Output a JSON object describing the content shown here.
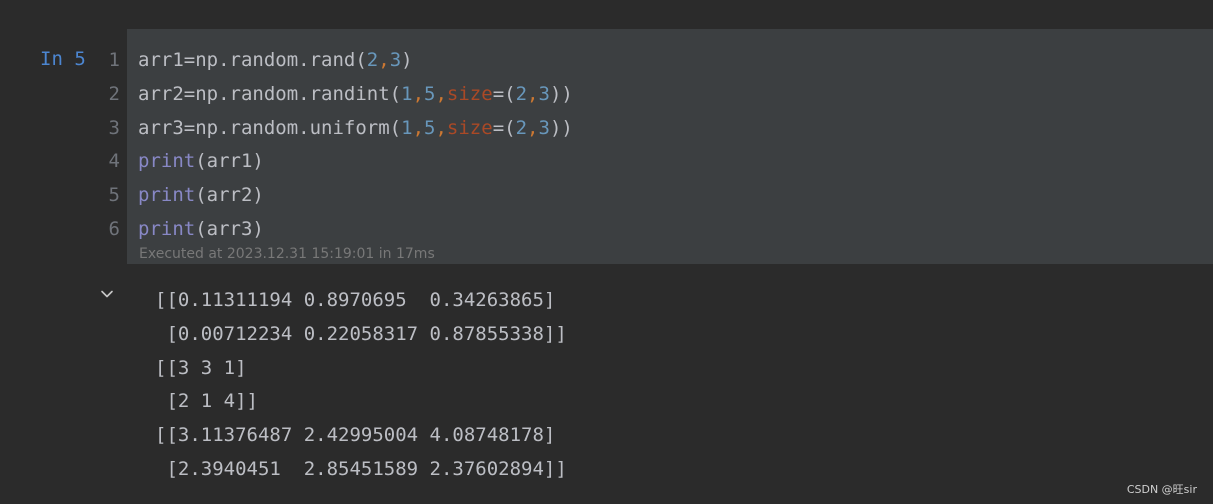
{
  "cell": {
    "label": "In 5",
    "line_numbers": [
      "1",
      "2",
      "3",
      "4",
      "5",
      "6"
    ],
    "code_lines": [
      [
        {
          "text": "arr1=np.random.rand(",
          "kind": "plain"
        },
        {
          "text": "2",
          "kind": "num"
        },
        {
          "text": ",",
          "kind": "comma"
        },
        {
          "text": "3",
          "kind": "num"
        },
        {
          "text": ")",
          "kind": "plain"
        }
      ],
      [
        {
          "text": "arr2=np.random.randint(",
          "kind": "plain"
        },
        {
          "text": "1",
          "kind": "num"
        },
        {
          "text": ",",
          "kind": "comma"
        },
        {
          "text": "5",
          "kind": "num"
        },
        {
          "text": ",",
          "kind": "comma"
        },
        {
          "text": "size",
          "kind": "kw"
        },
        {
          "text": "=(",
          "kind": "plain"
        },
        {
          "text": "2",
          "kind": "num"
        },
        {
          "text": ",",
          "kind": "comma"
        },
        {
          "text": "3",
          "kind": "num"
        },
        {
          "text": "))",
          "kind": "plain"
        }
      ],
      [
        {
          "text": "arr3=np.random.uniform(",
          "kind": "plain"
        },
        {
          "text": "1",
          "kind": "num"
        },
        {
          "text": ",",
          "kind": "comma"
        },
        {
          "text": "5",
          "kind": "num"
        },
        {
          "text": ",",
          "kind": "comma"
        },
        {
          "text": "size",
          "kind": "kw"
        },
        {
          "text": "=(",
          "kind": "plain"
        },
        {
          "text": "2",
          "kind": "num"
        },
        {
          "text": ",",
          "kind": "comma"
        },
        {
          "text": "3",
          "kind": "num"
        },
        {
          "text": "))",
          "kind": "plain"
        }
      ],
      [
        {
          "text": "print",
          "kind": "fn"
        },
        {
          "text": "(arr1)",
          "kind": "plain"
        }
      ],
      [
        {
          "text": "print",
          "kind": "fn"
        },
        {
          "text": "(arr2)",
          "kind": "plain"
        }
      ],
      [
        {
          "text": "print",
          "kind": "fn"
        },
        {
          "text": "(arr3)",
          "kind": "plain"
        }
      ]
    ],
    "execution_status": "Executed at 2023.12.31 15:19:01 in 17ms"
  },
  "output": {
    "collapse_icon": "chevron-down-icon",
    "lines": [
      "[[0.11311194 0.8970695  0.34263865]",
      " [0.00712234 0.22058317 0.87855338]]",
      "[[3 3 1]",
      " [2 1 4]]",
      "[[3.11376487 2.42995004 4.08748178]",
      " [2.3940451  2.85451589 2.37602894]]"
    ]
  },
  "watermark": "CSDN @旺sir",
  "colors": {
    "background": "#2b2b2b",
    "cell_background": "#3c3f41",
    "label": "#4c86d1",
    "text": "#bcbec4",
    "number": "#6897bb",
    "keyword_arg": "#aa4926",
    "builtin": "#8888c6",
    "comma": "#cc7832",
    "line_number": "#6f737a",
    "status": "#787878"
  }
}
